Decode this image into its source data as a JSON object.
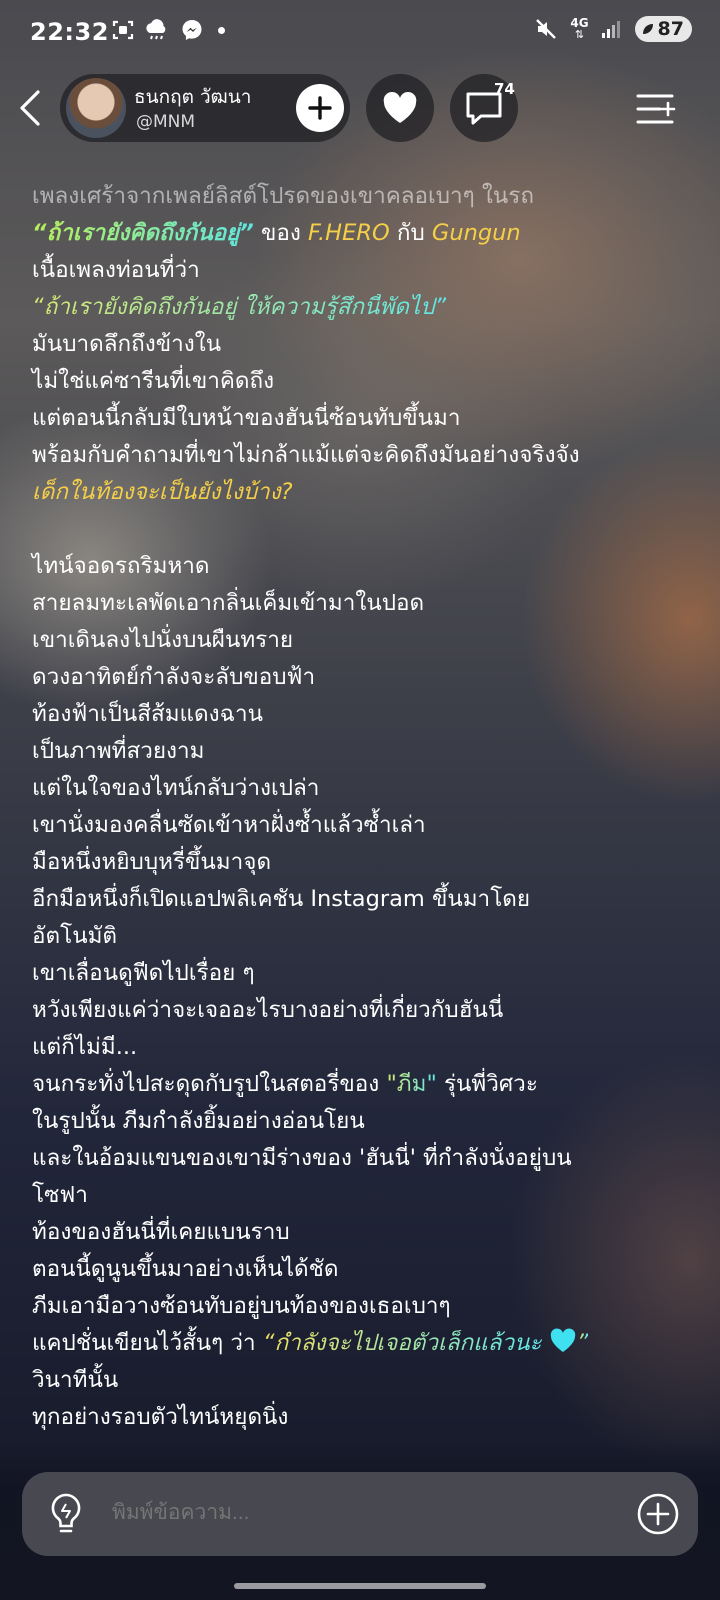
{
  "status": {
    "time": "22:32",
    "network": "4G",
    "battery": "87"
  },
  "header": {
    "author_name": "ธนกฤต วัฒนา",
    "author_handle": "@MNM",
    "comment_count": "74"
  },
  "story": {
    "l1": "เพลงเศร้าจากเพลย์ลิสต์โปรดของเขาคลอเบาๆ ในรถ",
    "l2_quote": "“ถ้าเรายังคิดถึงกันอยู่”",
    "l2_of": " ของ ",
    "l2_artist1": "F.HERO",
    "l2_with": " กับ ",
    "l2_artist2": "Gungun",
    "l3": "เนื้อเพลงท่อนที่ว่า",
    "l4_quote": "“ถ้าเรายังคิดถึงกันอยู่ ให้ความรู้สึกนี้พัดไป”",
    "l5": "มันบาดลึกถึงข้างใน",
    "l6": "ไม่ใช่แค่ซารีนที่เขาคิดถึง",
    "l7": "แต่ตอนนี้กลับมีใบหน้าของฮันนี่ซ้อนทับขึ้นมา",
    "l8": "พร้อมกับคำถามที่เขาไม่กล้าแม้แต่จะคิดถึงมันอย่างจริงจัง",
    "l9": "เด็กในท้องจะเป็นยังไงบ้าง?",
    "l10": "ไทน์จอดรถริมหาด",
    "l11": "สายลมทะเลพัดเอากลิ่นเค็มเข้ามาในปอด",
    "l12": "เขาเดินลงไปนั่งบนผืนทราย",
    "l13": "ดวงอาทิตย์กำลังจะลับขอบฟ้า",
    "l14": "ท้องฟ้าเป็นสีส้มแดงฉาน",
    "l15": "เป็นภาพที่สวยงาม",
    "l16": "แต่ในใจของไทน์กลับว่างเปล่า",
    "l17": "เขานั่งมองคลื่นซัดเข้าหาฝั่งซ้ำแล้วซ้ำเล่า",
    "l18": "มือหนึ่งหยิบบุหรี่ขึ้นมาจุด",
    "l19": "อีกมือหนึ่งก็เปิดแอปพลิเคชัน Instagram ขึ้นมาโดย",
    "l20": "อัตโนมัติ",
    "l21": "เขาเลื่อนดูฟีดไปเรื่อย ๆ",
    "l22": "หวังเพียงแค่ว่าจะเจออะไรบางอย่างที่เกี่ยวกับฮันนี่",
    "l23": "แต่ก็ไม่มี...",
    "l24_pre": "จนกระทั่งไปสะดุดกับรูปในสตอรี่ของ ",
    "l24_name": "\"ภีม\"",
    "l24_post": " รุ่นพี่วิศวะ",
    "l25": "ในรูปนั้น ภีมกำลังยิ้มอย่างอ่อนโยน",
    "l26": "และในอ้อมแขนของเขามีร่างของ 'ฮันนี่' ที่กำลังนั่งอยู่บน",
    "l27": "โซฟา",
    "l28": "ท้องของฮันนี่ที่เคยแบนราบ",
    "l29": "ตอนนี้ดูนูนขึ้นมาอย่างเห็นได้ชัด",
    "l30": "ภีมเอามือวางซ้อนทับอยู่บนท้องของเธอเบาๆ",
    "l31_pre": "แคปชั่นเขียนไว้สั้นๆ ว่า ",
    "l31_quote": "“กำลังจะไปเจอตัวเล็กแล้วนะ",
    "l31_close": "”",
    "l32": "วินาทีนั้น",
    "l33": "ทุกอย่างรอบตัวไทน์หยุดนิ่ง"
  },
  "input": {
    "placeholder": "พิมพ์ข้อความ..."
  },
  "icons": {
    "back": "chevron-left-icon",
    "follow": "plus-icon",
    "like": "heart-icon",
    "comment": "comment-bubble-icon",
    "menu": "chapter-list-icon",
    "idea": "lightbulb-icon",
    "add": "plus-circle-icon",
    "heart_emoji_color": "#3fe0f0"
  }
}
